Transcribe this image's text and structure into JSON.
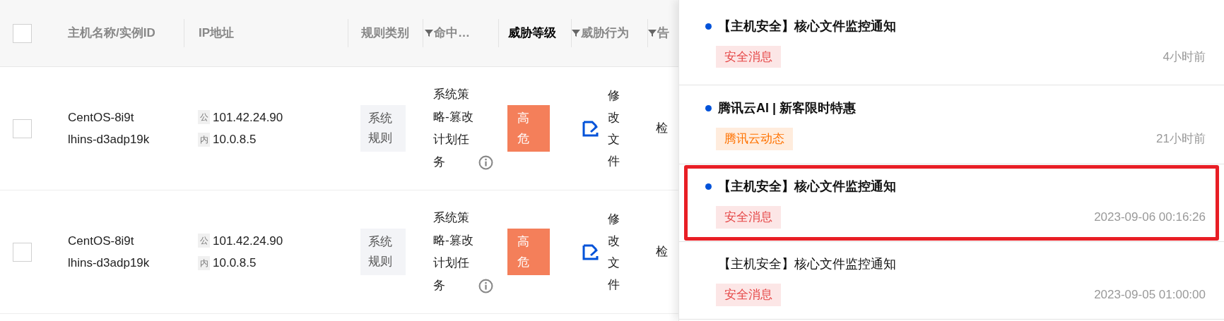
{
  "table": {
    "select_all": {
      "checked": false
    },
    "columns": [
      {
        "label": "主机名称/实例ID",
        "filter": false,
        "active": false
      },
      {
        "label": "IP地址",
        "filter": false,
        "active": false
      },
      {
        "label": "规则类别",
        "filter": false,
        "active": false
      },
      {
        "label": "命中…",
        "filter": true,
        "active": false
      },
      {
        "label": "威胁等级",
        "filter": false,
        "active": true
      },
      {
        "label": "威胁行为",
        "filter": true,
        "active": false
      },
      {
        "label": "告",
        "filter": true,
        "active": false
      }
    ],
    "rows": [
      {
        "checked": false,
        "host": "CentOS-8i9t",
        "instance": "lhins-d3adp19k",
        "ips": [
          {
            "badge": "公",
            "ip": "101.42.24.90"
          },
          {
            "badge": "内",
            "ip": "10.0.8.5"
          }
        ],
        "rule_type": "系统规则",
        "hit_rule": "系统策略-篡改计划任务",
        "level": "高危",
        "behavior": "修改文件",
        "alert": "检"
      },
      {
        "checked": false,
        "host": "CentOS-8i9t",
        "instance": "lhins-d3adp19k",
        "ips": [
          {
            "badge": "公",
            "ip": "101.42.24.90"
          },
          {
            "badge": "内",
            "ip": "10.0.8.5"
          }
        ],
        "rule_type": "系统规则",
        "hit_rule": "系统策略-篡改计划任务",
        "level": "高危",
        "behavior": "修改文件",
        "alert": "检"
      }
    ]
  },
  "notifications": [
    {
      "title": "【主机安全】核心文件监控通知",
      "unread": true,
      "highlighted": false,
      "tag": "安全消息",
      "color": "#e54545",
      "time": "4小时前"
    },
    {
      "title": "腾讯云AI | 新客限时特惠",
      "unread": true,
      "highlighted": false,
      "tag": "腾讯云动态",
      "color": "#ff7200",
      "time": "21小时前"
    },
    {
      "title": "【主机安全】核心文件监控通知",
      "unread": true,
      "highlighted": true,
      "tag": "安全消息",
      "color": "#e54545",
      "time": "2023-09-06 00:16:26"
    },
    {
      "title": "【主机安全】核心文件监控通知",
      "unread": false,
      "highlighted": false,
      "tag": "安全消息",
      "color": "#e54545",
      "time": "2023-09-05 01:00:00"
    }
  ]
}
